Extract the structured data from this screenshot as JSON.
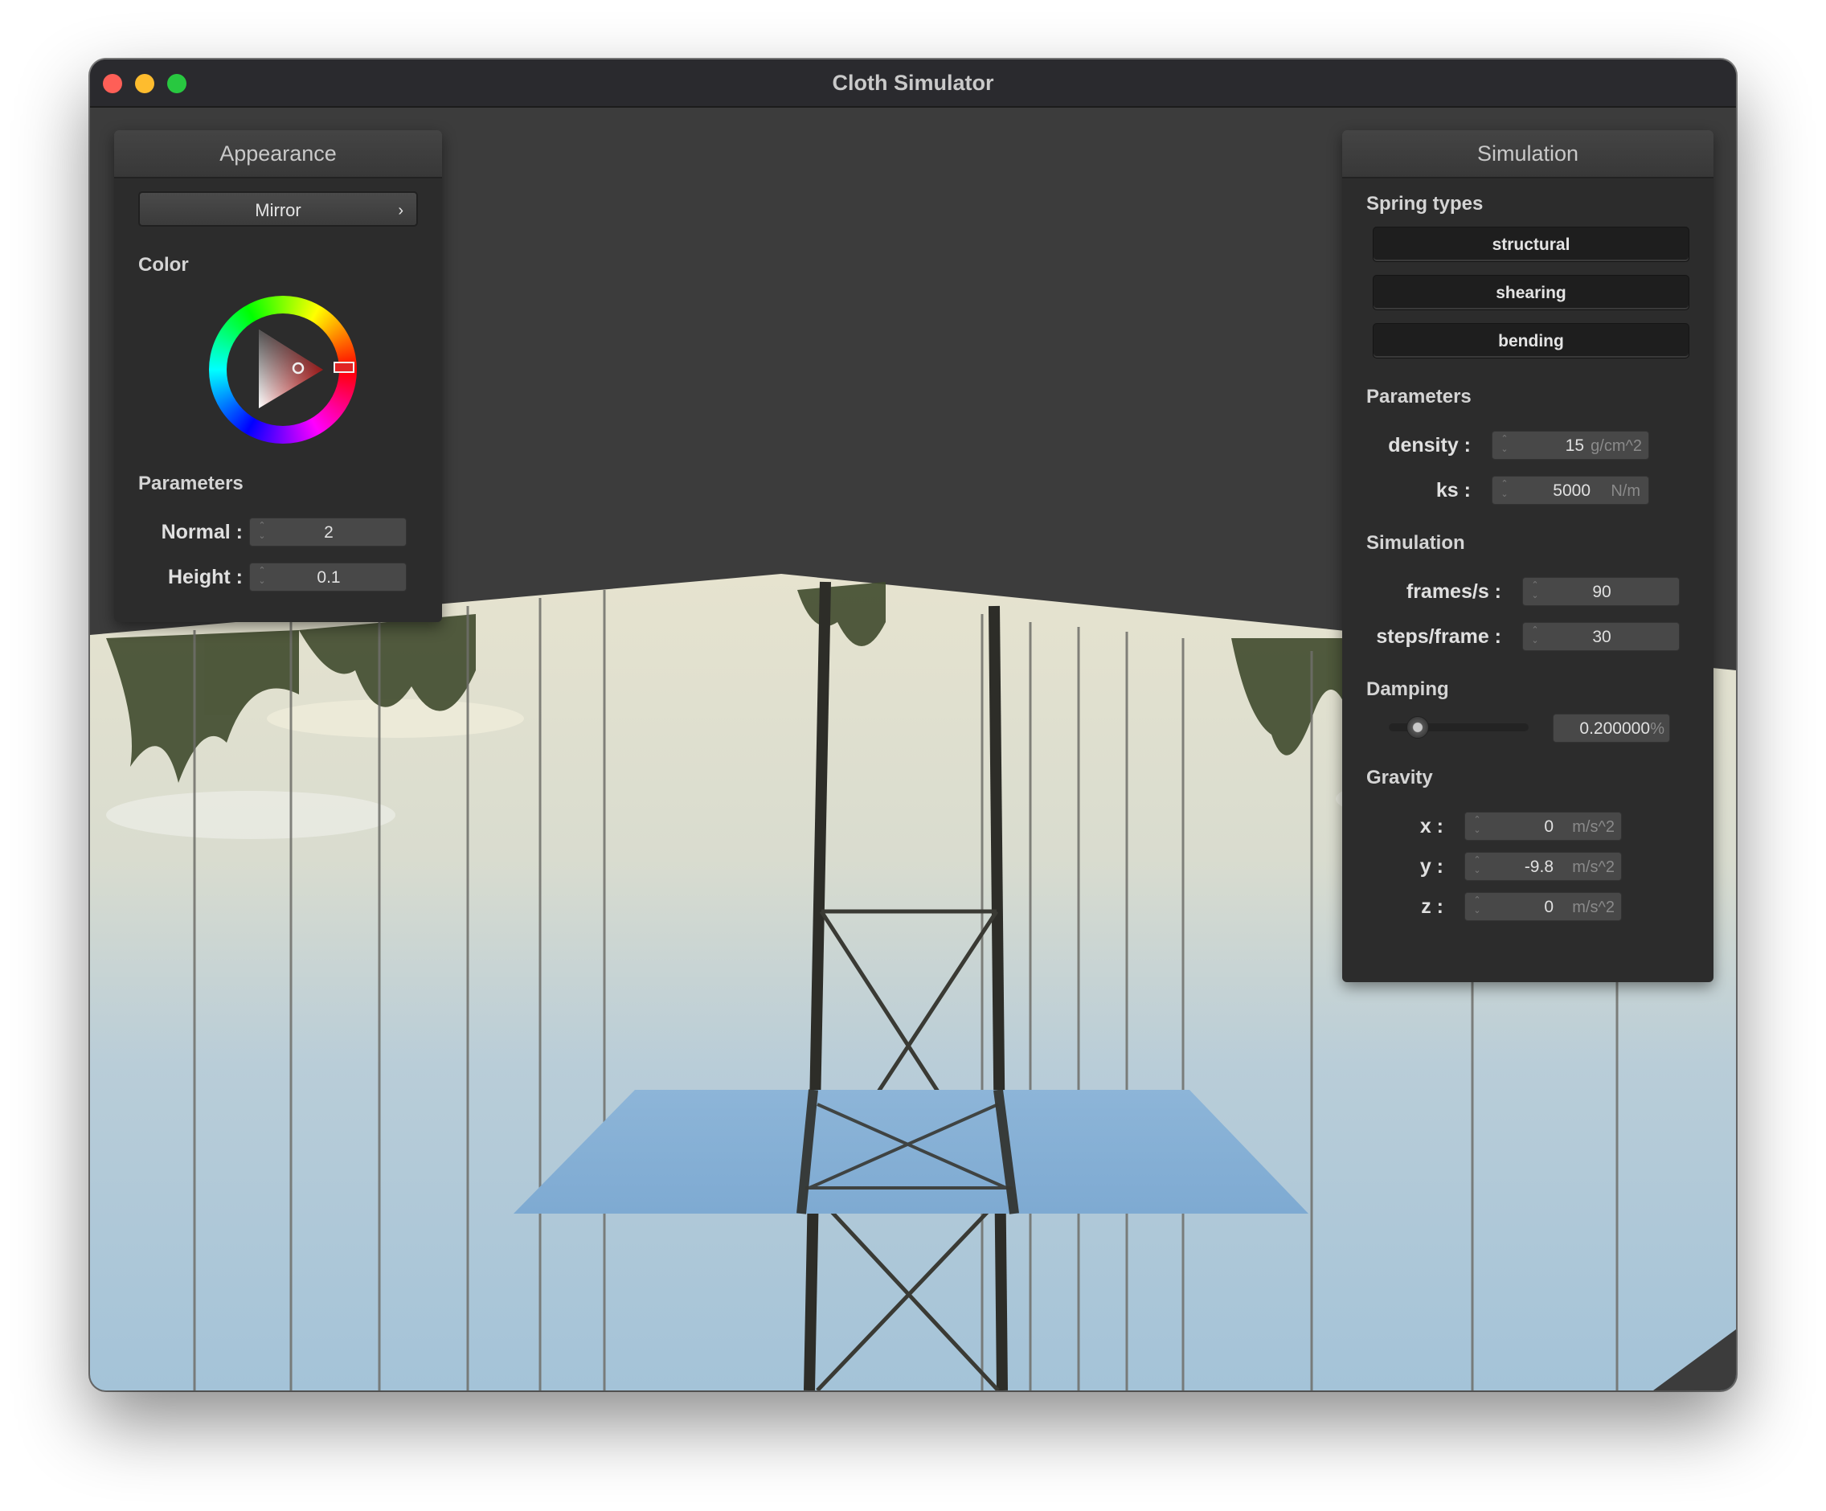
{
  "window": {
    "title": "Cloth Simulator"
  },
  "appearance": {
    "header": "Appearance",
    "shader": "Mirror",
    "color_label": "Color",
    "selected_color": "#e02424",
    "params_label": "Parameters",
    "normal_label": "Normal :",
    "normal_value": "2",
    "height_label": "Height :",
    "height_value": "0.1"
  },
  "simulation": {
    "header": "Simulation",
    "spring_types_label": "Spring types",
    "springs": [
      "structural",
      "shearing",
      "bending"
    ],
    "params_label": "Parameters",
    "density_label": "density :",
    "density_value": "15",
    "density_unit": "g/cm^2",
    "ks_label": "ks :",
    "ks_value": "5000",
    "ks_unit": "N/m",
    "sim_label": "Simulation",
    "fps_label": "frames/s :",
    "fps_value": "90",
    "steps_label": "steps/frame :",
    "steps_value": "30",
    "damping_label": "Damping",
    "damping_value": "0.200000",
    "damping_unit": "%",
    "damping_fraction": 0.2,
    "gravity_label": "Gravity",
    "gx_label": "x :",
    "gx_value": "0",
    "gy_label": "y :",
    "gy_value": "-9.8",
    "gz_label": "z :",
    "gz_value": "0",
    "g_unit": "m/s^2"
  }
}
